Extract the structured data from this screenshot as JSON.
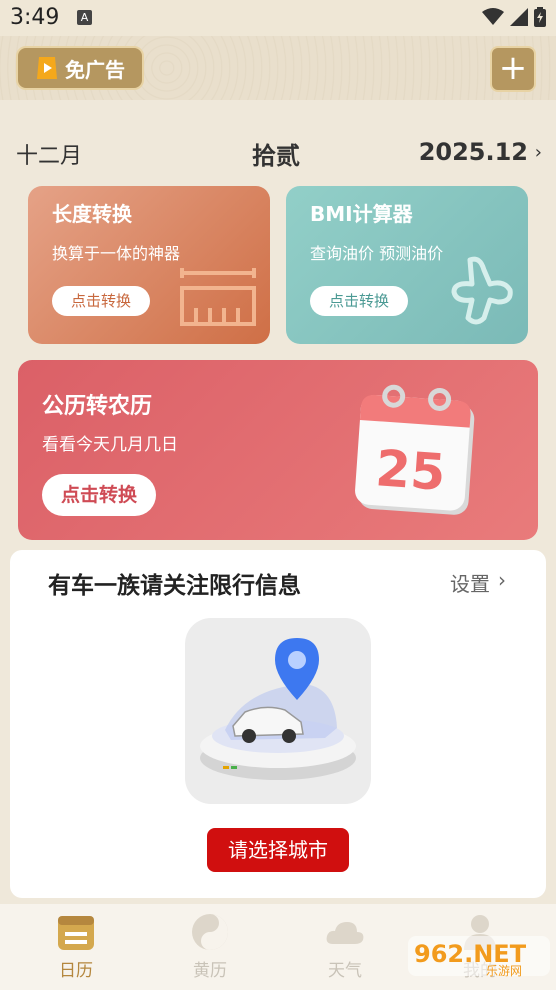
{
  "status": {
    "time": "3:49",
    "notif": "A"
  },
  "topbar": {
    "ad_label": "免广告",
    "plus": "+"
  },
  "date": {
    "month": "十二月",
    "day": "拾贰",
    "year_month": "2025.12",
    "chevron": "›"
  },
  "cards": {
    "length": {
      "title": "长度转换",
      "subtitle": "换算于一体的神器",
      "button": "点击转换"
    },
    "bmi": {
      "title": "BMI计算器",
      "subtitle": "查询油价 预测油价",
      "button": "点击转换"
    },
    "lunar": {
      "title": "公历转农历",
      "subtitle": "看看今天几月几日",
      "button": "点击转换",
      "calendar_number": "25"
    }
  },
  "traffic": {
    "title": "有车一族请关注限行信息",
    "setting": "设置",
    "chevron": "›",
    "city_button": "请选择城市"
  },
  "nav": [
    {
      "label": "日历",
      "icon": "calendar-icon",
      "active": true
    },
    {
      "label": "黄历",
      "icon": "yin-yang-icon",
      "active": false
    },
    {
      "label": "天气",
      "icon": "cloud-icon",
      "active": false
    },
    {
      "label": "我的",
      "icon": "user-icon",
      "active": false
    }
  ],
  "watermark": {
    "text": "962.NET",
    "sub": "乐游网"
  },
  "colors": {
    "accent": "#b59760",
    "lunar": "#db6067",
    "city_button": "#d00f0f",
    "nav_active": "#b5873e"
  }
}
